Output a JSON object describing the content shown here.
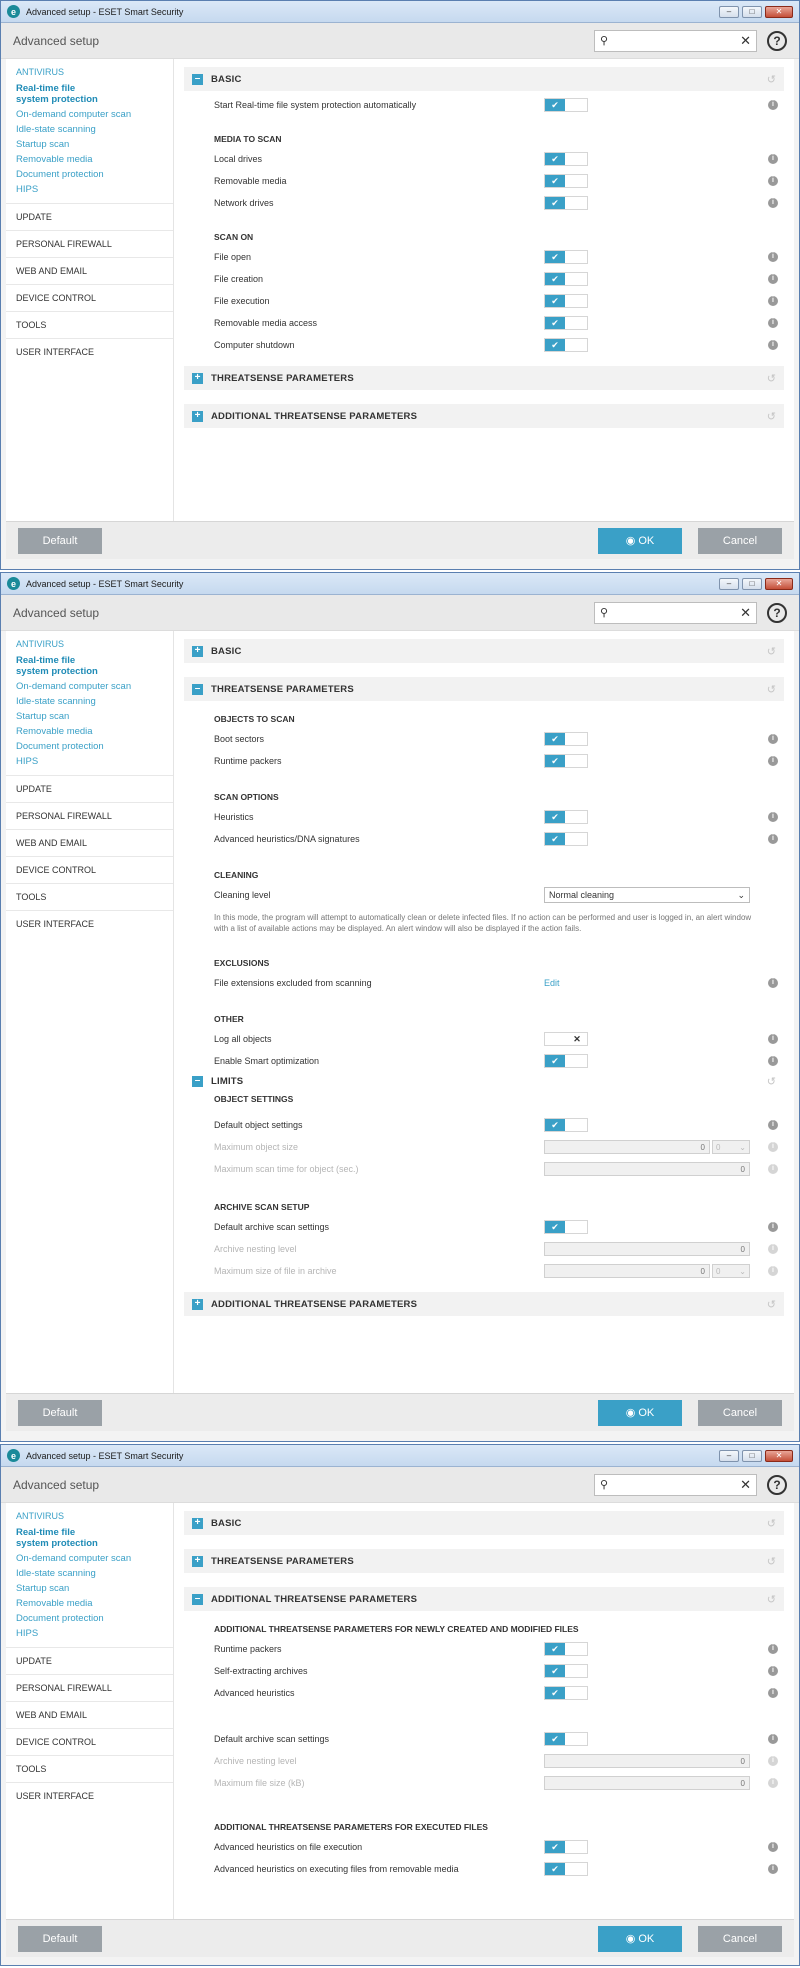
{
  "window": {
    "title": "Advanced setup - ESET Smart Security",
    "header": "Advanced setup",
    "search_placeholder": "",
    "help": "?"
  },
  "sidebar": {
    "antivirus": "ANTIVIRUS",
    "subitems": [
      "Real-time file system protection",
      "On-demand computer scan",
      "Idle-state scanning",
      "Startup scan",
      "Removable media",
      "Document protection",
      "HIPS"
    ],
    "categories": [
      "UPDATE",
      "PERSONAL FIREWALL",
      "WEB AND EMAIL",
      "DEVICE CONTROL",
      "TOOLS",
      "USER INTERFACE"
    ]
  },
  "footer": {
    "default": "Default",
    "ok": "OK",
    "cancel": "Cancel"
  },
  "s1": {
    "basic": "BASIC",
    "start_auto": "Start Real-time file system protection automatically",
    "media_head": "MEDIA TO SCAN",
    "local": "Local drives",
    "removable": "Removable media",
    "network": "Network drives",
    "scanon_head": "SCAN ON",
    "open": "File open",
    "creation": "File creation",
    "execution": "File execution",
    "rm_access": "Removable media access",
    "shutdown": "Computer shutdown",
    "threatsense": "THREATSENSE PARAMETERS",
    "additional": "ADDITIONAL THREATSENSE PARAMETERS"
  },
  "s2": {
    "basic": "BASIC",
    "threatsense": "THREATSENSE PARAMETERS",
    "objects_head": "OBJECTS TO SCAN",
    "boot": "Boot sectors",
    "packers": "Runtime packers",
    "options_head": "SCAN OPTIONS",
    "heuristics": "Heuristics",
    "adv_heur": "Advanced heuristics/DNA signatures",
    "cleaning_head": "CLEANING",
    "cleaning_level": "Cleaning level",
    "cleaning_value": "Normal cleaning",
    "cleaning_desc": "In this mode, the program will attempt to automatically clean or delete infected files. If no action can be performed and user is logged in, an alert window with a list of available actions may be displayed. An alert window will also be displayed if the action fails.",
    "excl_head": "EXCLUSIONS",
    "excl_label": "File extensions excluded from scanning",
    "edit": "Edit",
    "other_head": "OTHER",
    "log_all": "Log all objects",
    "smart": "Enable Smart optimization",
    "limits": "LIMITS",
    "objset_head": "OBJECT SETTINGS",
    "default_obj": "Default object settings",
    "max_obj": "Maximum object size",
    "max_time": "Maximum scan time for object (sec.)",
    "archive_head": "ARCHIVE SCAN SETUP",
    "default_arch": "Default archive scan settings",
    "nesting": "Archive nesting level",
    "max_file": "Maximum size of file in archive",
    "zero": "0",
    "unit": "0",
    "additional": "ADDITIONAL THREATSENSE PARAMETERS"
  },
  "s3": {
    "basic": "BASIC",
    "threatsense": "THREATSENSE PARAMETERS",
    "additional": "ADDITIONAL THREATSENSE PARAMETERS",
    "new_head": "ADDITIONAL THREATSENSE PARAMETERS FOR NEWLY CREATED AND MODIFIED FILES",
    "packers": "Runtime packers",
    "sfx": "Self-extracting archives",
    "adv": "Advanced heuristics",
    "default_arch": "Default archive scan settings",
    "nesting": "Archive nesting level",
    "max_file": "Maximum file size (kB)",
    "zero": "0",
    "exec_head": "ADDITIONAL THREATSENSE PARAMETERS FOR EXECUTED FILES",
    "adv_exec": "Advanced heuristics on file execution",
    "adv_rm": "Advanced heuristics on executing files from removable media"
  }
}
